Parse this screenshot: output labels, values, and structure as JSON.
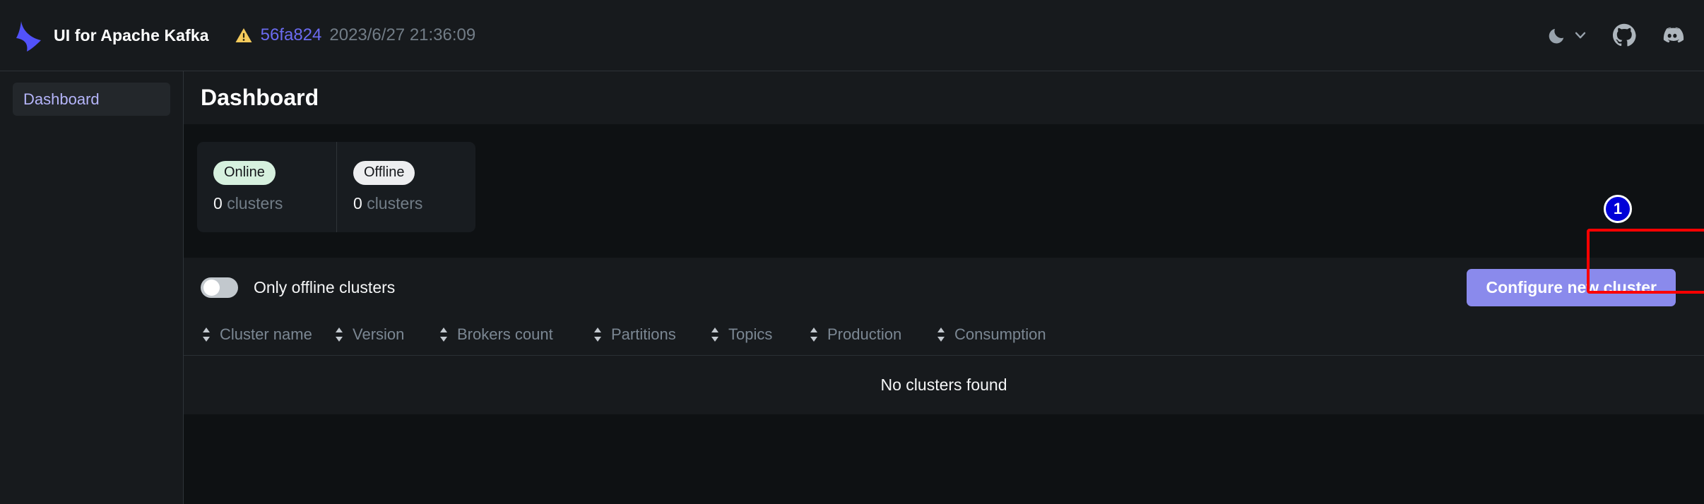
{
  "topbar": {
    "logo_icon": "kafka-logo-icon",
    "brand": "UI for Apache Kafka",
    "warning_icon": "warning-triangle-icon",
    "commit": "56fa824",
    "build_date": "2023/6/27 21:36:09",
    "theme_icon": "moon-icon",
    "theme_chevron_icon": "chevron-down-icon",
    "github_icon": "github-icon",
    "discord_icon": "discord-icon"
  },
  "sidebar": {
    "items": [
      {
        "label": "Dashboard",
        "active": true
      }
    ]
  },
  "page": {
    "title": "Dashboard"
  },
  "metrics": [
    {
      "status": "Online",
      "count": "0",
      "unit": "clusters",
      "color": "#d6f0de"
    },
    {
      "status": "Offline",
      "count": "0",
      "unit": "clusters",
      "color": "#edeef0"
    }
  ],
  "controls": {
    "toggle_label": "Only offline clusters",
    "toggle_on": false,
    "configure_button": "Configure new cluster",
    "configure_button_color": "#8a8aec"
  },
  "annotation": {
    "marker": "1",
    "marker_color": "#0000d8",
    "box_color": "#ff0000"
  },
  "table": {
    "columns": [
      {
        "label": "Cluster name",
        "sort_icon": "sort-icon"
      },
      {
        "label": "Version",
        "sort_icon": "sort-icon"
      },
      {
        "label": "Brokers count",
        "sort_icon": "sort-icon"
      },
      {
        "label": "Partitions",
        "sort_icon": "sort-icon"
      },
      {
        "label": "Topics",
        "sort_icon": "sort-icon"
      },
      {
        "label": "Production",
        "sort_icon": "sort-icon"
      },
      {
        "label": "Consumption",
        "sort_icon": "sort-icon"
      }
    ],
    "rows": [],
    "empty_message": "No clusters found"
  }
}
